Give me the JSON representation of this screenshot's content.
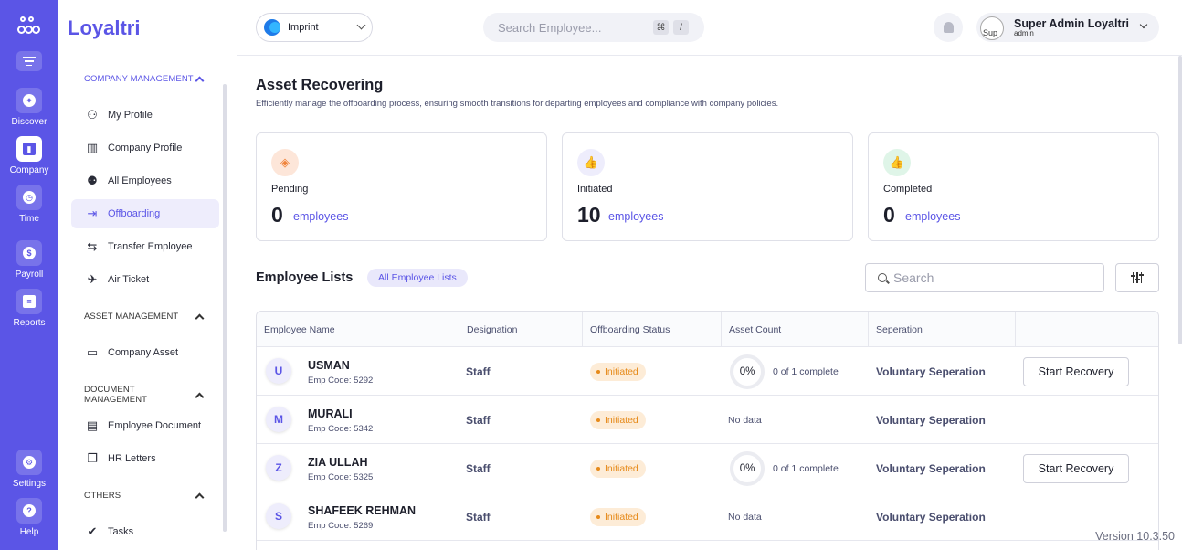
{
  "app": {
    "name": "Loyaltri",
    "version": "Version 10.3.50"
  },
  "rail": {
    "items": [
      {
        "label": "Discover",
        "icon": "compass-icon"
      },
      {
        "label": "Company",
        "icon": "building-icon"
      },
      {
        "label": "Time",
        "icon": "clock-icon"
      },
      {
        "label": "Payroll",
        "icon": "dollar-icon"
      },
      {
        "label": "Reports",
        "icon": "file-icon"
      }
    ],
    "bottom": [
      {
        "label": "Settings",
        "icon": "gear-icon"
      },
      {
        "label": "Help",
        "icon": "help-icon"
      }
    ]
  },
  "sidebar": {
    "sections": [
      {
        "title": "COMPANY MANAGEMENT"
      },
      {
        "title": "ASSET MANAGEMENT"
      },
      {
        "title": "DOCUMENT MANAGEMENT"
      },
      {
        "title": "OTHERS"
      }
    ],
    "items": [
      {
        "label": "My Profile"
      },
      {
        "label": "Company Profile"
      },
      {
        "label": "All Employees"
      },
      {
        "label": "Offboarding"
      },
      {
        "label": "Transfer Employee"
      },
      {
        "label": "Air Ticket"
      },
      {
        "label": "Company Asset"
      },
      {
        "label": "Employee Document"
      },
      {
        "label": "HR Letters"
      },
      {
        "label": "Tasks"
      }
    ]
  },
  "topbar": {
    "org": "Imprint",
    "search_placeholder": "Search Employee...",
    "kbd": [
      "⌘",
      "/"
    ],
    "user": {
      "name": "Super Admin Loyaltri",
      "role": "admin",
      "avatar_alt": "Sup"
    }
  },
  "page": {
    "title": "Asset Recovering",
    "subtitle": "Efficiently manage the offboarding process, ensuring smooth transitions for departing employees and compliance with company policies."
  },
  "stats": [
    {
      "label": "Pending",
      "value": "0",
      "unit": "employees",
      "color": "#f0833a"
    },
    {
      "label": "Initiated",
      "value": "10",
      "unit": "employees",
      "color": "#5b55e6"
    },
    {
      "label": "Completed",
      "value": "0",
      "unit": "employees",
      "color": "#22a661"
    }
  ],
  "list": {
    "title": "Employee Lists",
    "chip": "All Employee Lists",
    "search_placeholder": "Search",
    "columns": [
      "Employee Name",
      "Designation",
      "Offboarding Status",
      "Asset Count",
      "Seperation"
    ],
    "rows": [
      {
        "initial": "U",
        "name": "USMAN",
        "code": "Emp Code: 5292",
        "designation": "Staff",
        "status": "Initiated",
        "asset_pct": "0%",
        "asset_text": "0 of 1 complete",
        "separation": "Voluntary Seperation",
        "action": "Start Recovery"
      },
      {
        "initial": "M",
        "name": "MURALI",
        "code": "Emp Code: 5342",
        "designation": "Staff",
        "status": "Initiated",
        "asset_text": "No data",
        "separation": "Voluntary Seperation"
      },
      {
        "initial": "Z",
        "name": "ZIA ULLAH",
        "code": "Emp Code: 5325",
        "designation": "Staff",
        "status": "Initiated",
        "asset_pct": "0%",
        "asset_text": "0 of 1 complete",
        "separation": "Voluntary Seperation",
        "action": "Start Recovery"
      },
      {
        "initial": "S",
        "name": "SHAFEEK REHMAN",
        "code": "Emp Code: 5269",
        "designation": "Staff",
        "status": "Initiated",
        "asset_text": "No data",
        "separation": "Voluntary Seperation"
      }
    ]
  }
}
